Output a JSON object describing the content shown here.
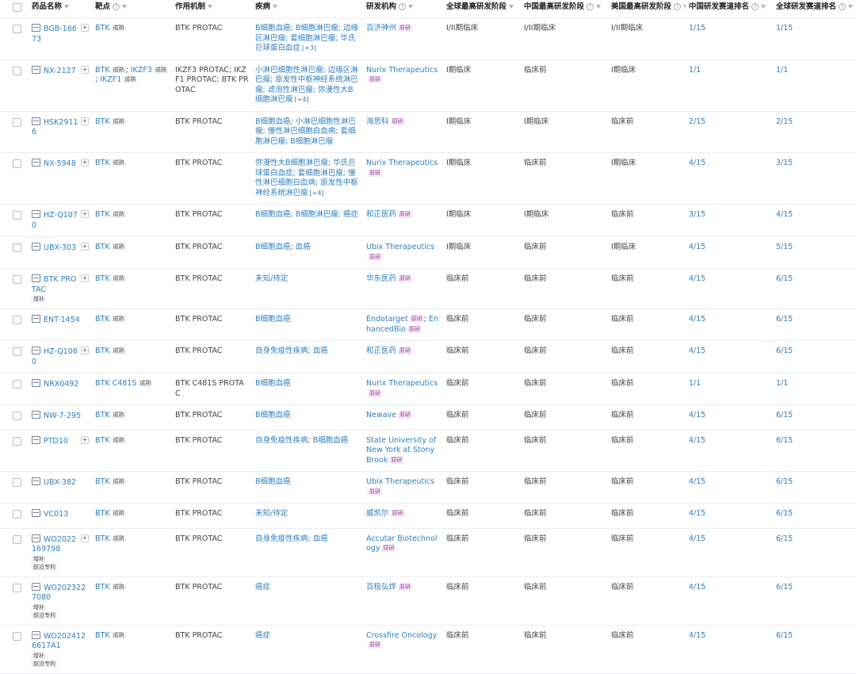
{
  "columns": [
    {
      "label": "药品名称",
      "help": false
    },
    {
      "label": "靶点",
      "help": true
    },
    {
      "label": "作用机制",
      "help": false
    },
    {
      "label": "疾病",
      "help": false
    },
    {
      "label": "研发机构",
      "help": true
    },
    {
      "label": "全球最高研发阶段",
      "help": false
    },
    {
      "label": "中国最高研发阶段",
      "help": true
    },
    {
      "label": "美国最高研发阶段",
      "help": true
    },
    {
      "label": "中国研发赛道排名",
      "help": true
    },
    {
      "label": "全球研发赛道排名",
      "help": true
    }
  ],
  "rows": [
    {
      "drug": "BGB-16673",
      "plus": true,
      "badges": [],
      "targets": [
        {
          "name": "BTK",
          "tag": "成熟"
        }
      ],
      "mechanism": "BTK PROTAC",
      "disease": "B细胞血癌; B细胞淋巴瘤; 边缘区淋巴瘤; 套细胞淋巴瘤; 华氏巨球蛋白血症",
      "disease_more": "[+3]",
      "orgs": [
        {
          "name": "百济神州",
          "tag": "原研"
        }
      ],
      "global_phase": "I/II期临床",
      "china_phase": "I/II期临床",
      "us_phase": "I/II期临床",
      "china_rank": "1/15",
      "global_rank": "1/15"
    },
    {
      "drug": "NX-2127",
      "plus": true,
      "badges": [],
      "targets": [
        {
          "name": "BTK",
          "tag": "成熟",
          "sep": ";"
        },
        {
          "name": "IKZF3",
          "tag": "成熟",
          "sep": ";"
        },
        {
          "name": "IKZF1",
          "tag": "成熟"
        }
      ],
      "mechanism": "IKZF3 PROTAC; IKZF1 PROTAC; BTK PROTAC",
      "disease": "小淋巴细胞性淋巴瘤; 边缘区淋巴瘤; 原发性中枢神经系统淋巴瘤; 滤泡性淋巴瘤; 弥漫性大B细胞淋巴瘤",
      "disease_more": "[+4]",
      "orgs": [
        {
          "name": "Nurix Therapeutics",
          "tag": "原研"
        }
      ],
      "global_phase": "I期临床",
      "china_phase": "临床前",
      "us_phase": "I期临床",
      "china_rank": "1/1",
      "global_rank": "1/1"
    },
    {
      "drug": "HSK29116",
      "plus": true,
      "badges": [],
      "targets": [
        {
          "name": "BTK",
          "tag": "成熟"
        }
      ],
      "mechanism": "BTK PROTAC",
      "disease": "B细胞血癌; 小淋巴细胞性淋巴瘤; 慢性淋巴细胞白血病; 套细胞淋巴瘤; B细胞淋巴瘤",
      "disease_more": "",
      "orgs": [
        {
          "name": "海思科",
          "tag": "原研"
        }
      ],
      "global_phase": "I期临床",
      "china_phase": "I期临床",
      "us_phase": "临床前",
      "china_rank": "2/15",
      "global_rank": "2/15"
    },
    {
      "drug": "NX-5948",
      "plus": true,
      "badges": [],
      "targets": [
        {
          "name": "BTK",
          "tag": "成熟"
        }
      ],
      "mechanism": "BTK PROTAC",
      "disease": "弥漫性大B细胞淋巴瘤; 华氏巨球蛋白血症; 套细胞淋巴瘤; 慢性淋巴细胞白血病; 原发性中枢神经系统淋巴瘤",
      "disease_more": "[+4]",
      "orgs": [
        {
          "name": "Nurix Therapeutics",
          "tag": "原研"
        }
      ],
      "global_phase": "I期临床",
      "china_phase": "临床前",
      "us_phase": "I期临床",
      "china_rank": "4/15",
      "global_rank": "3/15"
    },
    {
      "drug": "HZ-Q1070",
      "plus": true,
      "badges": [],
      "targets": [
        {
          "name": "BTK",
          "tag": "成熟"
        }
      ],
      "mechanism": "BTK PROTAC",
      "disease": "B细胞血癌; B细胞淋巴瘤; 癌症",
      "disease_more": "",
      "orgs": [
        {
          "name": "和正医药",
          "tag": "原研"
        }
      ],
      "global_phase": "I期临床",
      "china_phase": "I期临床",
      "us_phase": "临床前",
      "china_rank": "3/15",
      "global_rank": "4/15"
    },
    {
      "drug": "UBX-303",
      "plus": true,
      "badges": [],
      "targets": [
        {
          "name": "BTK",
          "tag": "成熟"
        }
      ],
      "mechanism": "BTK PROTAC",
      "disease": "B细胞血癌; 血癌",
      "disease_more": "",
      "orgs": [
        {
          "name": "Ubix Therapeutics",
          "tag": "原研"
        }
      ],
      "global_phase": "I期临床",
      "china_phase": "临床前",
      "us_phase": "I期临床",
      "china_rank": "4/15",
      "global_rank": "5/15"
    },
    {
      "drug": "BTK PROTAC",
      "plus": true,
      "badges": [
        "增补"
      ],
      "targets": [
        {
          "name": "BTK",
          "tag": "成熟"
        }
      ],
      "mechanism": "BTK PROTAC",
      "disease": "未知/待定",
      "disease_more": "",
      "orgs": [
        {
          "name": "华东医药",
          "tag": "原研"
        }
      ],
      "global_phase": "临床前",
      "china_phase": "临床前",
      "us_phase": "临床前",
      "china_rank": "4/15",
      "global_rank": "6/15"
    },
    {
      "drug": "ENT-1454",
      "plus": false,
      "badges": [],
      "targets": [
        {
          "name": "BTK",
          "tag": "成熟"
        }
      ],
      "mechanism": "BTK PROTAC",
      "disease": "B细胞血癌",
      "disease_more": "",
      "orgs": [
        {
          "name": "Endotarget",
          "tag": "原研",
          "sep": ";"
        },
        {
          "name": "EnhancedBio",
          "tag": "原研"
        }
      ],
      "global_phase": "临床前",
      "china_phase": "临床前",
      "us_phase": "临床前",
      "china_rank": "4/15",
      "global_rank": "6/15"
    },
    {
      "drug": "HZ-Q1060",
      "plus": true,
      "badges": [],
      "targets": [
        {
          "name": "BTK",
          "tag": "成熟"
        }
      ],
      "mechanism": "BTK PROTAC",
      "disease": "自身免疫性疾病; 血癌",
      "disease_more": "",
      "orgs": [
        {
          "name": "和正医药",
          "tag": "原研"
        }
      ],
      "global_phase": "临床前",
      "china_phase": "临床前",
      "us_phase": "临床前",
      "china_rank": "4/15",
      "global_rank": "6/15"
    },
    {
      "drug": "NRX0492",
      "plus": false,
      "badges": [],
      "targets": [
        {
          "name": "BTK C481S",
          "tag": "成熟"
        }
      ],
      "mechanism": "BTK C481S PROTAC",
      "disease": "B细胞血癌",
      "disease_more": "",
      "orgs": [
        {
          "name": "Nurix Therapeutics",
          "tag": "原研"
        }
      ],
      "global_phase": "临床前",
      "china_phase": "临床前",
      "us_phase": "临床前",
      "china_rank": "1/1",
      "global_rank": "1/1"
    },
    {
      "drug": "NW-7-295",
      "plus": false,
      "badges": [],
      "targets": [
        {
          "name": "BTK",
          "tag": "成熟"
        }
      ],
      "mechanism": "BTK PROTAC",
      "disease": "B细胞血癌",
      "disease_more": "",
      "orgs": [
        {
          "name": "Newave",
          "tag": "原研"
        }
      ],
      "global_phase": "临床前",
      "china_phase": "临床前",
      "us_phase": "临床前",
      "china_rank": "4/15",
      "global_rank": "6/15"
    },
    {
      "drug": "PTD10",
      "plus": true,
      "badges": [],
      "targets": [
        {
          "name": "BTK",
          "tag": "成熟"
        }
      ],
      "mechanism": "BTK PROTAC",
      "disease": "自身免疫性疾病; B细胞血癌",
      "disease_more": "",
      "orgs": [
        {
          "name": "State University of New York at Stony Brook",
          "tag": "原研"
        }
      ],
      "global_phase": "临床前",
      "china_phase": "临床前",
      "us_phase": "临床前",
      "china_rank": "4/15",
      "global_rank": "6/15"
    },
    {
      "drug": "UBX-382",
      "plus": false,
      "badges": [],
      "targets": [
        {
          "name": "BTK",
          "tag": "成熟"
        }
      ],
      "mechanism": "BTK PROTAC",
      "disease": "B细胞血癌",
      "disease_more": "",
      "orgs": [
        {
          "name": "Ubix Therapeutics",
          "tag": "原研"
        }
      ],
      "global_phase": "临床前",
      "china_phase": "临床前",
      "us_phase": "临床前",
      "china_rank": "4/15",
      "global_rank": "6/15"
    },
    {
      "drug": "VC013",
      "plus": false,
      "badges": [],
      "targets": [
        {
          "name": "BTK",
          "tag": "成熟"
        }
      ],
      "mechanism": "BTK PROTAC",
      "disease": "未知/待定",
      "disease_more": "",
      "orgs": [
        {
          "name": "威凯尔",
          "tag": "原研"
        }
      ],
      "global_phase": "临床前",
      "china_phase": "临床前",
      "us_phase": "临床前",
      "china_rank": "4/15",
      "global_rank": "6/15"
    },
    {
      "drug": "WO2022169798",
      "plus": true,
      "badges": [
        "增补",
        "前沿专利"
      ],
      "targets": [
        {
          "name": "BTK",
          "tag": "成熟"
        }
      ],
      "mechanism": "BTK PROTAC",
      "disease": "自身免疫性疾病; 血癌",
      "disease_more": "",
      "orgs": [
        {
          "name": "Accutar Biotechnology",
          "tag": "原研"
        }
      ],
      "global_phase": "临床前",
      "china_phase": "临床前",
      "us_phase": "临床前",
      "china_rank": "4/15",
      "global_rank": "6/15"
    },
    {
      "drug": "WO2023227080",
      "plus": false,
      "badges": [
        "增补",
        "前沿专利"
      ],
      "targets": [
        {
          "name": "BTK",
          "tag": "成熟"
        }
      ],
      "mechanism": "BTK PROTAC",
      "disease": "癌症",
      "disease_more": "",
      "orgs": [
        {
          "name": "百极弘烨",
          "tag": "原研"
        }
      ],
      "global_phase": "临床前",
      "china_phase": "临床前",
      "us_phase": "临床前",
      "china_rank": "4/15",
      "global_rank": "6/15"
    },
    {
      "drug": "WO2024126617A1",
      "plus": false,
      "badges": [
        "增补",
        "前沿专利"
      ],
      "targets": [
        {
          "name": "BTK",
          "tag": "成熟"
        }
      ],
      "mechanism": "BTK PROTAC",
      "disease": "癌症",
      "disease_more": "",
      "orgs": [
        {
          "name": "Crossfire Oncology",
          "tag": "原研"
        }
      ],
      "global_phase": "临床前",
      "china_phase": "临床前",
      "us_phase": "临床前",
      "china_rank": "4/15",
      "global_rank": "6/15"
    }
  ]
}
